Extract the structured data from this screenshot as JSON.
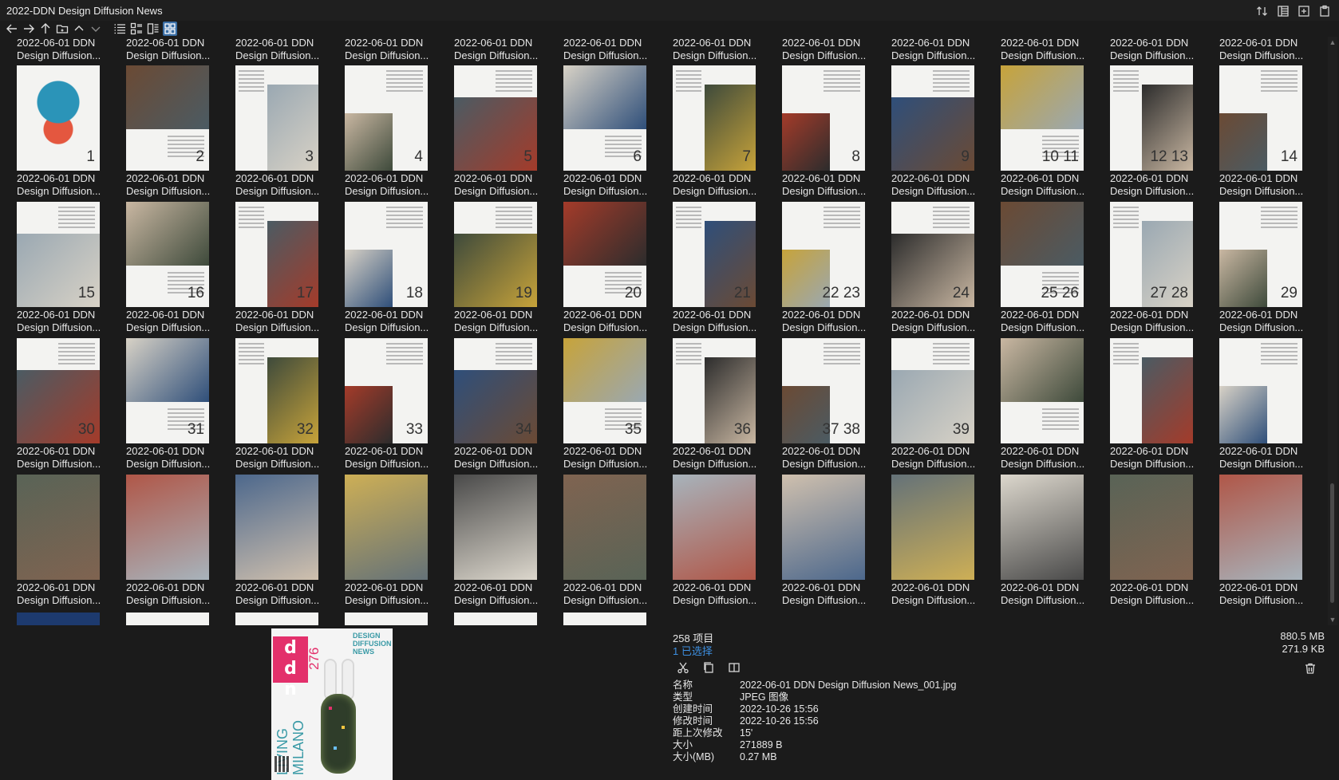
{
  "window": {
    "title": "2022-DDN Design Diffusion News"
  },
  "tile_label_line1": "2022-06-01 DDN",
  "tile_label_line2": "Design Diffusion...",
  "pages": [
    "1",
    "2",
    "3",
    "4",
    "5",
    "6",
    "7",
    "8",
    "9",
    "10 11",
    "12 13",
    "14",
    "15",
    "16",
    "17",
    "18",
    "19",
    "20",
    "21",
    "22 23",
    "24",
    "25 26",
    "27 28",
    "29",
    "30",
    "31",
    "32",
    "33",
    "34",
    "35",
    "36",
    "37 38",
    "39",
    "",
    "",
    "",
    "",
    "",
    "",
    "",
    "",
    "",
    "",
    "",
    "",
    "",
    "",
    ""
  ],
  "status": {
    "item_count": "258 项目",
    "selected": "1 已选择",
    "total_size": "880.5 MB",
    "selected_size": "271.9 KB"
  },
  "properties": [
    {
      "key": "名称",
      "value": "2022-06-01 DDN Design Diffusion News_001.jpg"
    },
    {
      "key": "类型",
      "value": "JPEG 图像"
    },
    {
      "key": "创建时间",
      "value": "2022-10-26  15:56"
    },
    {
      "key": "修改时间",
      "value": "2022-10-26  15:56"
    },
    {
      "key": "距上次修改",
      "value": "15'"
    },
    {
      "key": "大小",
      "value": "271889 B"
    },
    {
      "key": "大小(MB)",
      "value": "0.27 MB"
    }
  ],
  "preview": {
    "logo": "ddn",
    "issue": "276",
    "brand": "DESIGN DIFFUSION NEWS",
    "headline": "LIVING MILANO",
    "accent": "#e3306b",
    "teal": "#3a9aa6"
  },
  "icons": {
    "top": [
      "sort-icon",
      "details-view-icon",
      "new-window-icon",
      "clipboard-icon"
    ],
    "nav": [
      "back-icon",
      "forward-icon",
      "up-icon",
      "folder-icon",
      "chevron-up-icon",
      "chevron-down-icon",
      "list-view-icon",
      "tile-view-icon",
      "detail-tile-view-icon",
      "grid-view-icon"
    ],
    "file": [
      "cut-icon",
      "copy-icon",
      "duplicate-icon"
    ]
  }
}
